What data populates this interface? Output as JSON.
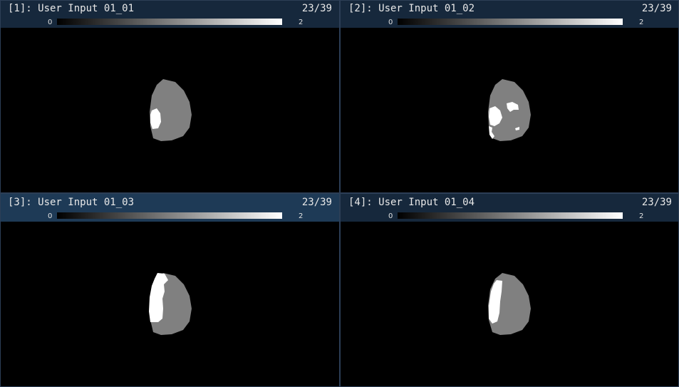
{
  "colormap": {
    "min_label": "0",
    "max_label": "2",
    "from": "#000000",
    "to": "#ffffff"
  },
  "panes": [
    {
      "title": "[1]: User Input 01_01",
      "counter": "23/39",
      "active": false
    },
    {
      "title": "[2]: User Input 01_02",
      "counter": "23/39",
      "active": false
    },
    {
      "title": "[3]: User Input 01_03",
      "counter": "23/39",
      "active": true
    },
    {
      "title": "[4]: User Input 01_04",
      "counter": "23/39",
      "active": false
    }
  ],
  "colors": {
    "mask_gray": "#808080",
    "mask_white": "#ffffff",
    "header": "#16283c",
    "header_active": "#1e3a56"
  }
}
